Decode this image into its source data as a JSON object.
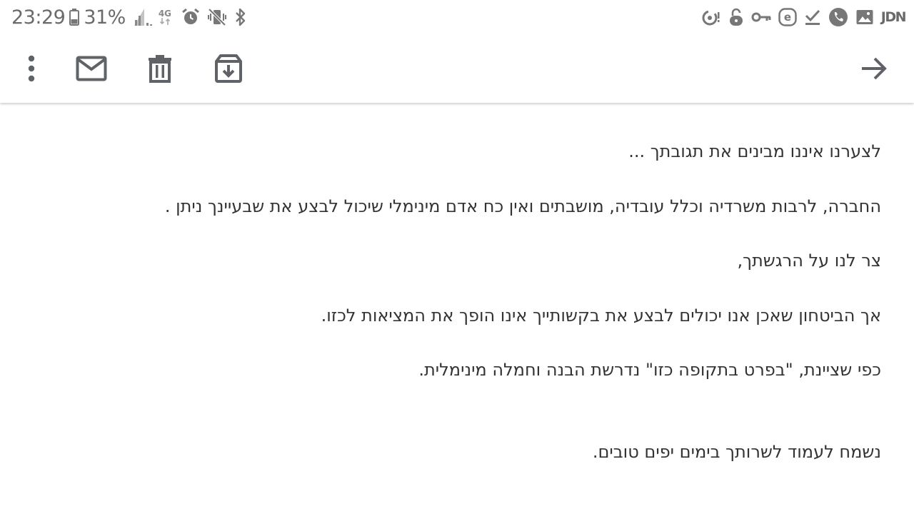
{
  "status_bar": {
    "time": "23:29",
    "battery_percent": "31%",
    "network_type": "4G",
    "right_text_icon": "JDN",
    "left_icons": [
      "battery-icon",
      "signal-icon",
      "network-4g-icon",
      "alarm-icon",
      "vibrate-off-icon",
      "bluetooth-icon"
    ],
    "right_icons": [
      "data-saver-icon",
      "lock-icon",
      "vpn-key-icon",
      "e-app-icon",
      "checkmark-icon",
      "phone-icon",
      "image-icon",
      "jdn-app-icon"
    ]
  },
  "toolbar": {
    "icons": [
      "more-vert-icon",
      "mark-unread-icon",
      "delete-icon",
      "archive-icon",
      "forward-arrow-icon"
    ]
  },
  "message": {
    "lines": [
      "לצערנו איננו מבינים את תגובתך ...",
      "החברה, לרבות משרדיה וכלל עובדיה, מושבתים ואין כח אדם מינימלי שיכול לבצע את שבעיינך ניתן .",
      "צר לנו על הרגשתך,",
      "אך הביטחון שאכן אנו יכולים לבצע את בקשותייך אינו הופך את המציאות לכזו.",
      "כפי שציינת, \"בפרט בתקופה כזו\" נדרשת הבנה וחמלה מינימלית.",
      "נשמח לעמוד לשרותך בימים יפים טובים."
    ]
  },
  "colors": {
    "icon_gray": "#666666",
    "text": "#333333",
    "background": "#ffffff"
  }
}
